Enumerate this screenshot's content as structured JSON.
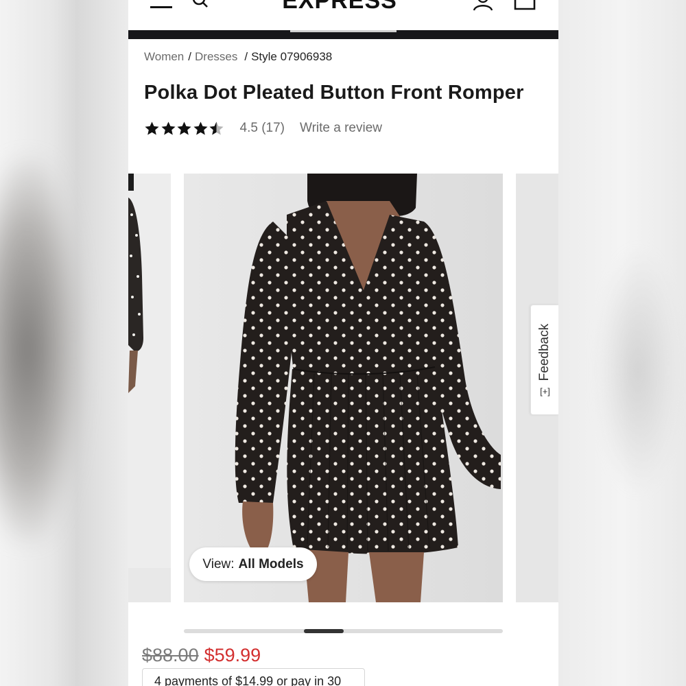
{
  "header": {
    "logo": "EXPRESS"
  },
  "breadcrumb": {
    "items": [
      "Women",
      "Dresses"
    ],
    "separator": "/",
    "current": "Style 07906938"
  },
  "product": {
    "title": "Polka Dot Pleated Button Front Romper",
    "rating_value": "4.5",
    "rating_stars": 4.5,
    "review_count": "(17)",
    "write_review": "Write a review",
    "price_original": "$88.00",
    "price_sale": "$59.99",
    "installments": "4 payments of $14.99 or pay in 30"
  },
  "gallery": {
    "view_prefix": "View:",
    "view_value": "All Models",
    "scroll_position": 0.43
  },
  "feedback": {
    "label": "Feedback",
    "icon": "[+]"
  },
  "colors": {
    "accent_sale": "#d32f2f",
    "header_bar": "#17171a"
  }
}
